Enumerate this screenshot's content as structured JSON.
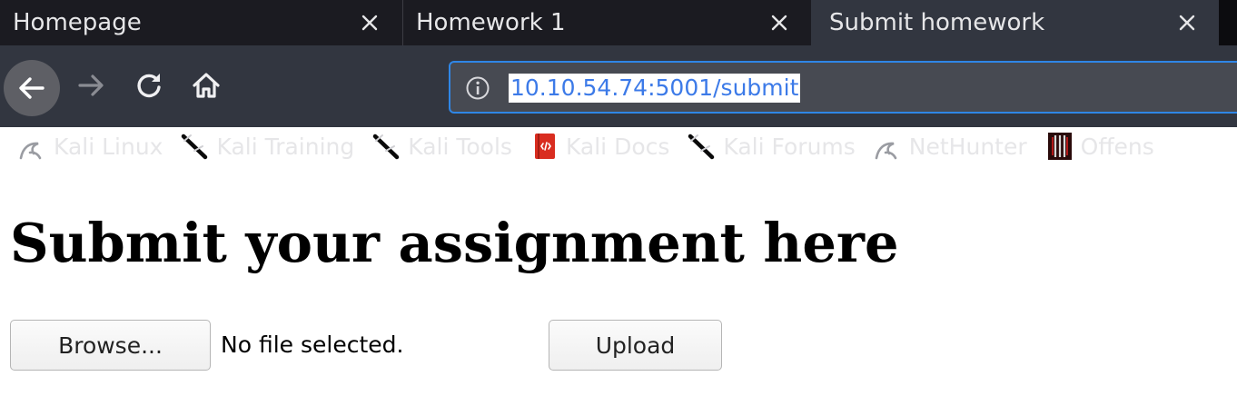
{
  "browser": {
    "tabs": [
      {
        "title": "Homepage",
        "active": false
      },
      {
        "title": "Homework 1",
        "active": false
      },
      {
        "title": "Submit homework",
        "active": true
      }
    ],
    "url": "10.10.54.74:5001/submit",
    "bookmarks": [
      {
        "label": "Kali Linux",
        "icon": "kali-dragon-icon"
      },
      {
        "label": "Kali Training",
        "icon": "kali-sword-icon"
      },
      {
        "label": "Kali Tools",
        "icon": "kali-sword-icon"
      },
      {
        "label": "Kali Docs",
        "icon": "docs-book-icon"
      },
      {
        "label": "Kali Forums",
        "icon": "kali-sword-icon"
      },
      {
        "label": "NetHunter",
        "icon": "kali-dragon-icon"
      },
      {
        "label": "Offens",
        "icon": "offensive-security-icon"
      }
    ]
  },
  "page": {
    "heading": "Submit your assignment here",
    "browse_label": "Browse...",
    "file_status": "No file selected.",
    "upload_label": "Upload"
  },
  "colors": {
    "tab_strip": "#0c0c0f",
    "toolbar": "#323640",
    "url_highlight": "#3c7ae8",
    "focus_ring": "#2f86e6"
  }
}
